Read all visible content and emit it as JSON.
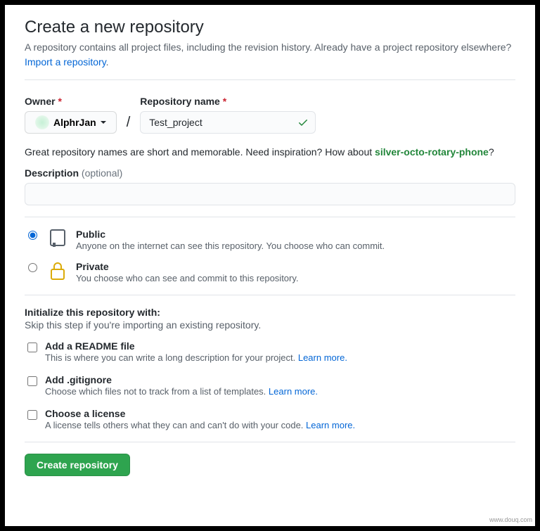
{
  "title": "Create a new repository",
  "lead": "A repository contains all project files, including the revision history. Already have a project repository elsewhere?",
  "import_link": "Import a repository",
  "owner": {
    "label": "Owner",
    "name": "AlphrJan"
  },
  "repo": {
    "label": "Repository name",
    "value": "Test_project"
  },
  "hint_prefix": "Great repository names are short and memorable. Need inspiration? How about ",
  "hint_suggestion": "silver-octo-rotary-phone",
  "hint_q": "?",
  "description": {
    "label": "Description",
    "optional": "(optional)",
    "value": ""
  },
  "visibility": {
    "public": {
      "title": "Public",
      "sub": "Anyone on the internet can see this repository. You choose who can commit."
    },
    "private": {
      "title": "Private",
      "sub": "You choose who can see and commit to this repository."
    }
  },
  "init": {
    "heading": "Initialize this repository with:",
    "sub": "Skip this step if you're importing an existing repository.",
    "readme": {
      "title": "Add a README file",
      "sub": "This is where you can write a long description for your project. ",
      "learn": "Learn more."
    },
    "gitignore": {
      "title": "Add .gitignore",
      "sub": "Choose which files not to track from a list of templates. ",
      "learn": "Learn more."
    },
    "license": {
      "title": "Choose a license",
      "sub": "A license tells others what they can and can't do with your code. ",
      "learn": "Learn more."
    }
  },
  "submit": "Create repository",
  "watermark": "www.douq.com"
}
